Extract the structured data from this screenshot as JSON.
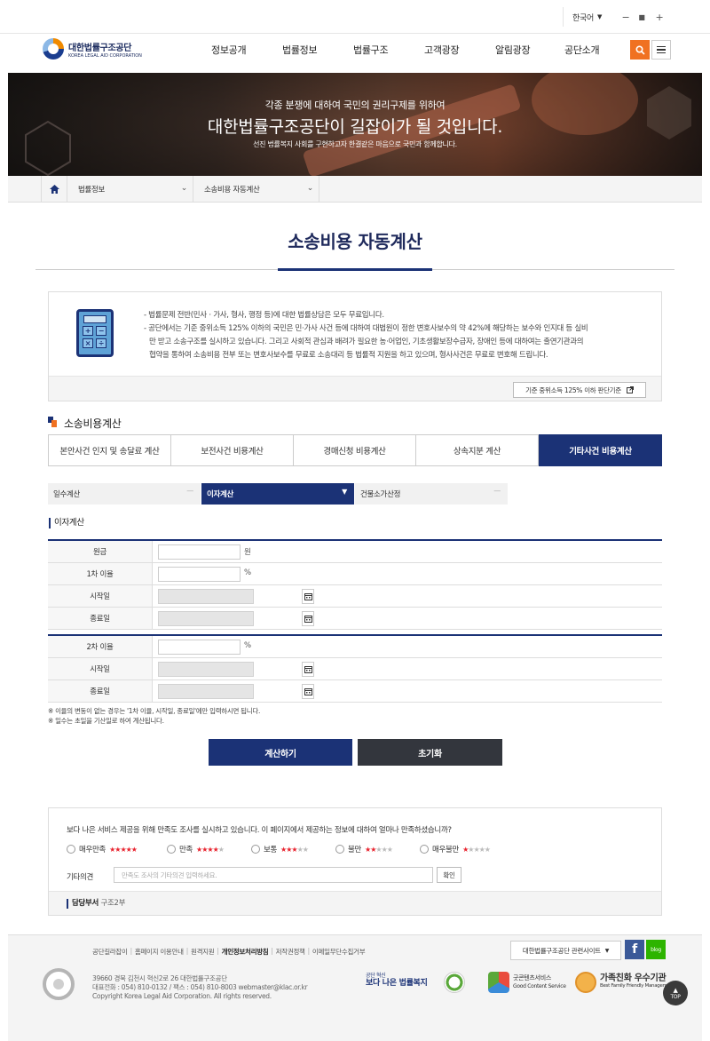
{
  "util": {
    "lang": "한국어",
    "zoom_out": "−",
    "zoom_reset": "■",
    "zoom_in": "+"
  },
  "brand": {
    "name_ko": "대한법률구조공단",
    "name_en": "KOREA LEGAL AID CORPORATION"
  },
  "nav": [
    "정보공개",
    "법률정보",
    "법률구조",
    "고객광장",
    "알림광장",
    "공단소개"
  ],
  "hero": {
    "sub": "각종 분쟁에 대하여 국민의 권리구제를 위하여",
    "title": "대한법률구조공단이 길잡이가 될 것입니다.",
    "desc": "선진 법률복지 사회를 구현하고자 한결같은 마음으로 국민과 함께합니다."
  },
  "breadcrumb": [
    "법률정보",
    "소송비용 자동계산"
  ],
  "page_title": "소송비용 자동계산",
  "calc_keys": [
    "+",
    "−",
    "×",
    "÷"
  ],
  "info": {
    "line1": "- 법률문제 전반(민사ㆍ가사, 형사, 행정 등)에 대한 법률상담은 모두 무료입니다.",
    "line2": "- 공단에서는 기준 중위소득 125% 이하의 국민은 민·가사 사건 등에 대하여 대법원이 정한 변호사보수의 약 42%에 해당하는 보수와 인지대 등 실비",
    "line3": "만 받고 소송구조를 실시하고 있습니다. 그리고 사회적 관심과 배려가 필요한 농·어업인, 기초생활보장수급자, 장애인 등에 대하여는 출연기관과의",
    "line4": "협약을 통하여 소송비용 전부 또는 변호사보수를 무료로 소송대리 등 법률적 지원을 하고 있으며, 형사사건은 무료로 변호해 드립니다.",
    "criteria_button": "기준 중위소득 125% 이하 판단기준"
  },
  "section_title": "소송비용계산",
  "tabs": [
    "본안사건 인지 및 송달료 계산",
    "보전사건 비용계산",
    "경매신청 비용계산",
    "상속지분 계산",
    "기타사건 비용계산"
  ],
  "active_tab": 4,
  "subtabs": [
    "일수계산",
    "이자계산",
    "건물소가산정"
  ],
  "active_subtab": 1,
  "form": {
    "heading": "이자계산",
    "principal_label": "원금",
    "principal_unit": "원",
    "rate1_label": "1차 이율",
    "rate_unit": "%",
    "start1_label": "시작일",
    "end1_label": "종료일",
    "rate2_label": "2차 이율",
    "start2_label": "시작일",
    "end2_label": "종료일"
  },
  "notes": [
    "※ 이율의 변동이 없는 경우는 '1차 이율, 시작일, 종료일'에만 입력하시면 됩니다.",
    "※ 일수는 초일을 기산일로 하여 계산됩니다."
  ],
  "buttons": {
    "calculate": "계산하기",
    "reset": "초기화"
  },
  "survey": {
    "question": "보다 나은 서비스 제공을 위해 만족도 조사를 실시하고 있습니다. 이 페이지에서 제공하는 정보에 대하여 얼마나 만족하셨습니까?",
    "options": [
      {
        "label": "매우만족",
        "stars": 5
      },
      {
        "label": "만족",
        "stars": 4
      },
      {
        "label": "보통",
        "stars": 3
      },
      {
        "label": "불만",
        "stars": 2
      },
      {
        "label": "매우불만",
        "stars": 1
      }
    ],
    "opinion_label": "기타의견",
    "opinion_placeholder": "만족도 조사의 기타의견 입력하세요.",
    "confirm": "확인",
    "dept_label": "담당부서",
    "dept_value": "구조2부"
  },
  "footer": {
    "links": [
      "공단길라잡이",
      "홈페이지 이용안내",
      "원격지원",
      "개인정보처리방침",
      "저작권정책",
      "이메일무단수집거부"
    ],
    "related_sites": "대한법률구조공단 관련사이트",
    "address": "39660 경북 김천시 혁신2로 26 대한법률구조공단",
    "contact": "대표전화 : 054) 810-0132 / 팩스 : 054) 810-8003 webmaster@klac.or.kr",
    "copyright": "Copyright Korea Legal Aid Corporation. All rights reserved.",
    "certs": {
      "bok_small": "공단 혁신",
      "bok_big": "보다 나은 법률복지",
      "gcs1": "굿콘텐츠서비스",
      "gcs2": "Good Content Service",
      "family1": "가족친화 우수기관",
      "family2": "Best Family Friendly Management"
    },
    "facebook": "f",
    "blog": "blog",
    "top": "TOP"
  }
}
